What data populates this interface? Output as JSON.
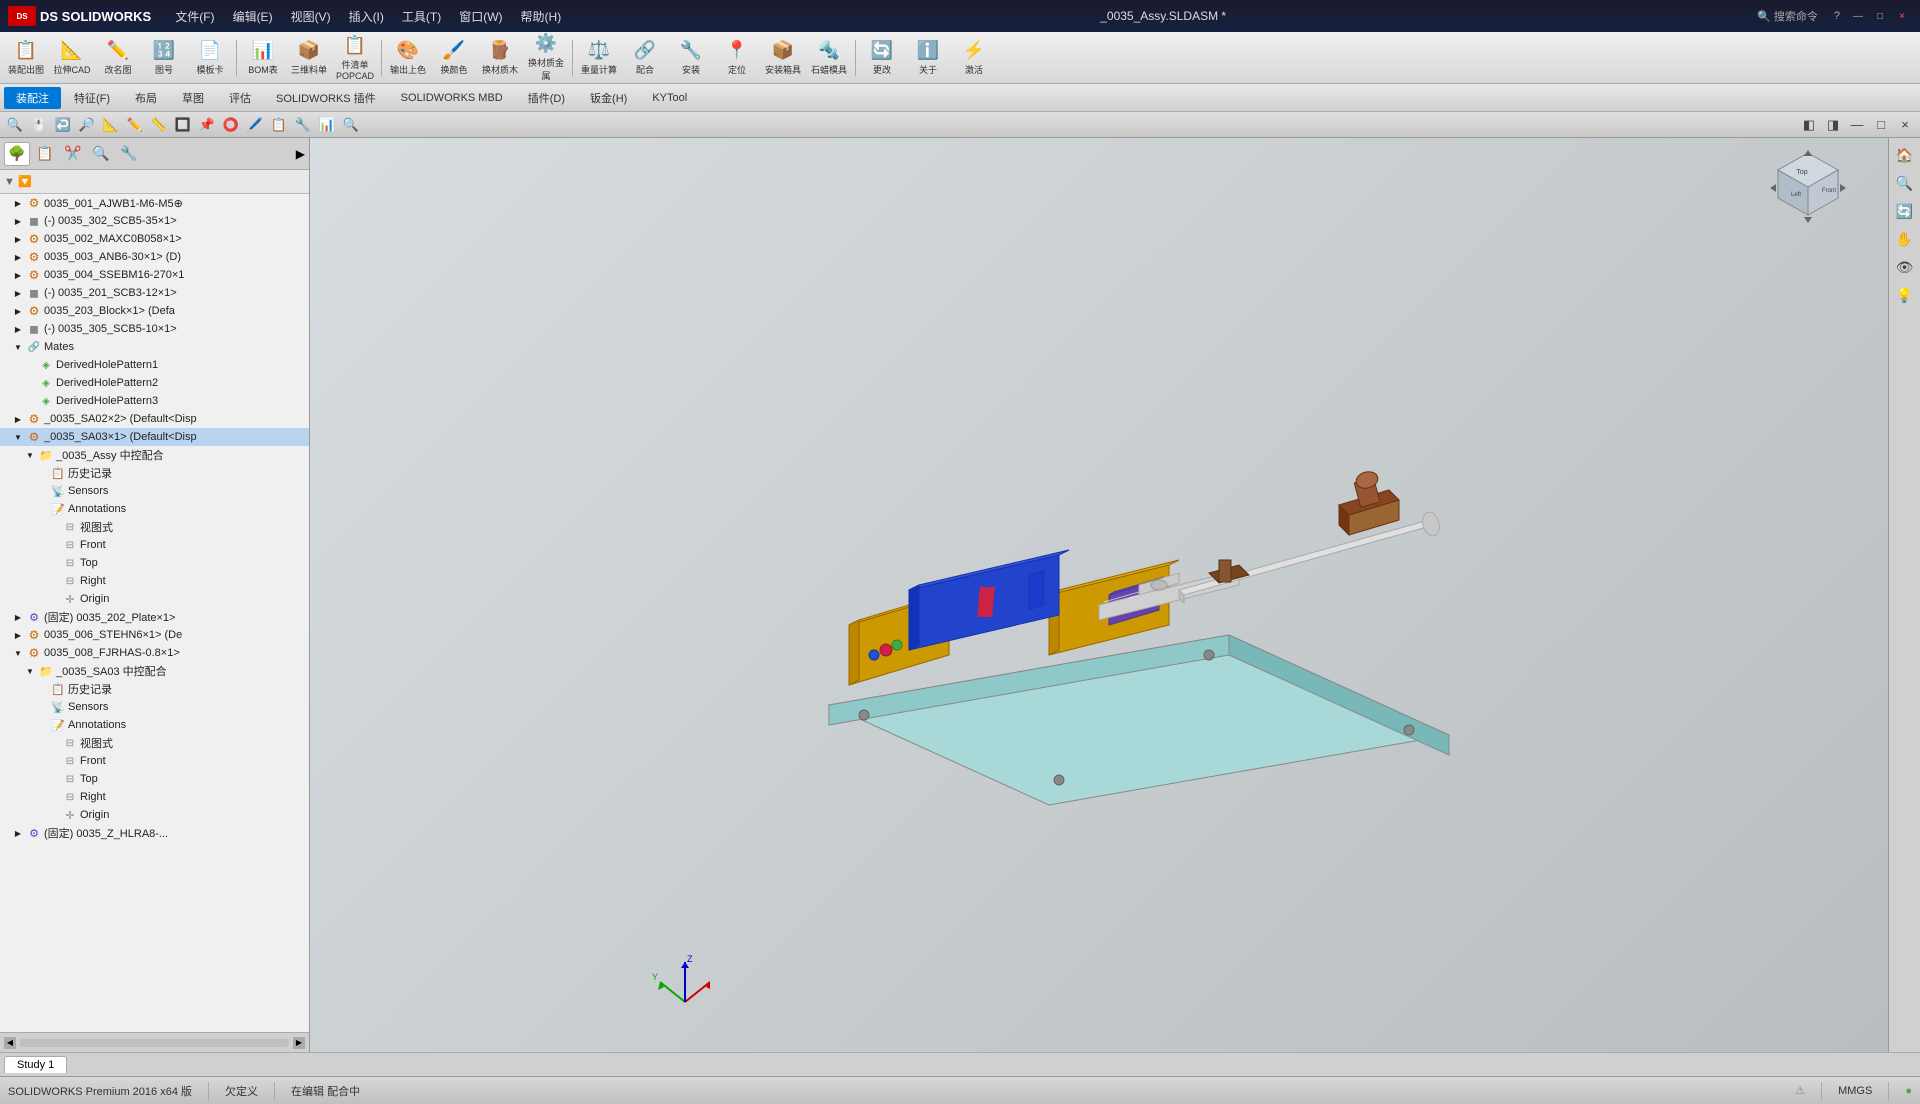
{
  "titlebar": {
    "logo": "DS SOLIDWORKS",
    "menus": [
      "文件(F)",
      "编辑(E)",
      "视图(V)",
      "插入(I)",
      "工具(T)",
      "窗口(W)",
      "帮助(H)"
    ],
    "title": "_0035_Assy.SLDASM *",
    "search_placeholder": "搜索命令",
    "win_controls": [
      "—",
      "□",
      "×"
    ]
  },
  "toolbar1": {
    "buttons": [
      {
        "label": "装配出图",
        "icon": "📋"
      },
      {
        "label": "拉伸CAD",
        "icon": "📐"
      },
      {
        "label": "改名图",
        "icon": "✏️"
      },
      {
        "label": "图号",
        "icon": "🔢"
      },
      {
        "label": "模板卡",
        "icon": "📄"
      },
      {
        "label": "BOM表",
        "icon": "📊"
      },
      {
        "label": "三维料单",
        "icon": "📦"
      },
      {
        "label": "件清单POPCAD",
        "icon": "📋"
      },
      {
        "label": "输出上色",
        "icon": "🎨"
      },
      {
        "label": "换颜色",
        "icon": "🖌️"
      },
      {
        "label": "换材质木",
        "icon": "🪵"
      },
      {
        "label": "换材质金属",
        "icon": "⚙️"
      },
      {
        "label": "重量计算",
        "icon": "⚖️"
      },
      {
        "label": "配合",
        "icon": "🔗"
      },
      {
        "label": "安装",
        "icon": "🔧"
      },
      {
        "label": "定位",
        "icon": "📍"
      },
      {
        "label": "安装箱具",
        "icon": "📦"
      },
      {
        "label": "石蜡模具",
        "icon": "🔩"
      },
      {
        "label": "更改",
        "icon": "🔄"
      },
      {
        "label": "关于",
        "icon": "ℹ️"
      },
      {
        "label": "激活",
        "icon": "⚡"
      }
    ]
  },
  "toolbar2": {
    "tabs": [
      "装配注",
      "特征(F)",
      "布局",
      "草图",
      "评估",
      "SOLIDWORKS 插件",
      "SOLIDWORKS MBD",
      "插件(D)",
      "钣金(H)",
      "KYTool"
    ]
  },
  "viewtoolbar": {
    "buttons": [
      "🔍",
      "🖱️",
      "↩️",
      "🔎",
      "📐",
      "✏️",
      "📏",
      "🔲",
      "📌",
      "⭕",
      "🖊️",
      "📋",
      "🔧",
      "📊",
      "🔍"
    ]
  },
  "panel_tabs": [
    "🌳",
    "📋",
    "✂️",
    "🔍",
    "🔧",
    "▶"
  ],
  "tree": {
    "items": [
      {
        "id": "item1",
        "label": "0035_001_AJWB1-M6-M5⊕",
        "level": 1,
        "icon": "assy",
        "expanded": false
      },
      {
        "id": "item2",
        "label": "(-) 0035_302_SCB5-35×1>",
        "level": 1,
        "icon": "part",
        "expanded": false
      },
      {
        "id": "item3",
        "label": "0035_002_MAXC0B058×1>",
        "level": 1,
        "icon": "assy",
        "expanded": false
      },
      {
        "id": "item4",
        "label": "0035_003_ANB6-30×1> (D)",
        "level": 1,
        "icon": "assy",
        "expanded": false
      },
      {
        "id": "item5",
        "label": "0035_004_SSEBM16-270×1",
        "level": 1,
        "icon": "assy",
        "expanded": false
      },
      {
        "id": "item6",
        "label": "(-) 0035_201_SCB3-12×1>",
        "level": 1,
        "icon": "part",
        "expanded": false
      },
      {
        "id": "item7",
        "label": "0035_203_Block×1> (Defa",
        "level": 1,
        "icon": "assy",
        "expanded": false
      },
      {
        "id": "item8",
        "label": "(-) 0035_305_SCB5-10×1>",
        "level": 1,
        "icon": "part",
        "expanded": false
      },
      {
        "id": "mates",
        "label": "Mates",
        "level": 1,
        "icon": "mate",
        "expanded": true
      },
      {
        "id": "derived1",
        "label": "DerivedHolePattern1",
        "level": 2,
        "icon": "feature"
      },
      {
        "id": "derived2",
        "label": "DerivedHolePattern2",
        "level": 2,
        "icon": "feature"
      },
      {
        "id": "derived3",
        "label": "DerivedHolePattern3",
        "level": 2,
        "icon": "feature"
      },
      {
        "id": "sa02",
        "label": "_0035_SA02×2> (Default<Disp",
        "level": 1,
        "icon": "assy",
        "expanded": false
      },
      {
        "id": "sa03_1",
        "label": "_0035_SA03×1> (Default<Disp",
        "level": 1,
        "icon": "assy",
        "expanded": true
      },
      {
        "id": "sa03_assy",
        "label": "_0035_Assy 中控配合",
        "level": 2,
        "icon": "folder"
      },
      {
        "id": "history",
        "label": "历史记录",
        "level": 3,
        "icon": "history"
      },
      {
        "id": "sensors",
        "label": "Sensors",
        "level": 3,
        "icon": "sensor"
      },
      {
        "id": "annotations",
        "label": "Annotations",
        "level": 3,
        "icon": "annot"
      },
      {
        "id": "format",
        "label": "视图式",
        "level": 4,
        "icon": "plane"
      },
      {
        "id": "front",
        "label": "Front",
        "level": 4,
        "icon": "plane"
      },
      {
        "id": "top",
        "label": "Top",
        "level": 4,
        "icon": "plane"
      },
      {
        "id": "right",
        "label": "Right",
        "level": 4,
        "icon": "plane"
      },
      {
        "id": "origin",
        "label": "Origin",
        "level": 4,
        "icon": "origin"
      },
      {
        "id": "plate",
        "label": "(固定) 0035_202_Plate×1>",
        "level": 1,
        "icon": "fixed_part",
        "expanded": false
      },
      {
        "id": "steh",
        "label": "0035_006_STEHN6×1> (De",
        "level": 1,
        "icon": "assy",
        "expanded": false
      },
      {
        "id": "rha",
        "label": "0035_008_FJRHAS-0.8×1>",
        "level": 1,
        "icon": "assy",
        "expanded": true
      },
      {
        "id": "rha_sa03",
        "label": "_0035_SA03 中控配合",
        "level": 2,
        "icon": "folder"
      },
      {
        "id": "rha_history",
        "label": "历史记录",
        "level": 3,
        "icon": "history"
      },
      {
        "id": "rha_sensors",
        "label": "Sensors",
        "level": 3,
        "icon": "sensor"
      },
      {
        "id": "rha_annotations",
        "label": "Annotations",
        "level": 3,
        "icon": "annot"
      },
      {
        "id": "rha_format",
        "label": "视图式",
        "level": 4,
        "icon": "plane"
      },
      {
        "id": "rha_front",
        "label": "Front",
        "level": 4,
        "icon": "plane"
      },
      {
        "id": "rha_top",
        "label": "Top",
        "level": 4,
        "icon": "plane"
      },
      {
        "id": "rha_right",
        "label": "Right",
        "level": 4,
        "icon": "plane"
      },
      {
        "id": "rha_origin",
        "label": "Origin",
        "level": 4,
        "icon": "origin"
      },
      {
        "id": "last",
        "label": "(固定) 0035_Z_HLRA8-...",
        "level": 1,
        "icon": "fixed_part",
        "expanded": false
      }
    ]
  },
  "statusbar": {
    "left": "SOLIDWORKS Premium 2016 x64 版",
    "status1": "欠定义",
    "status2": "在编辑 配合中",
    "unit": "MMGS",
    "indicator": "●"
  },
  "bottom_tabs": [
    "Study 1"
  ],
  "viewport": {
    "bg_color": "#cdd2d5"
  }
}
